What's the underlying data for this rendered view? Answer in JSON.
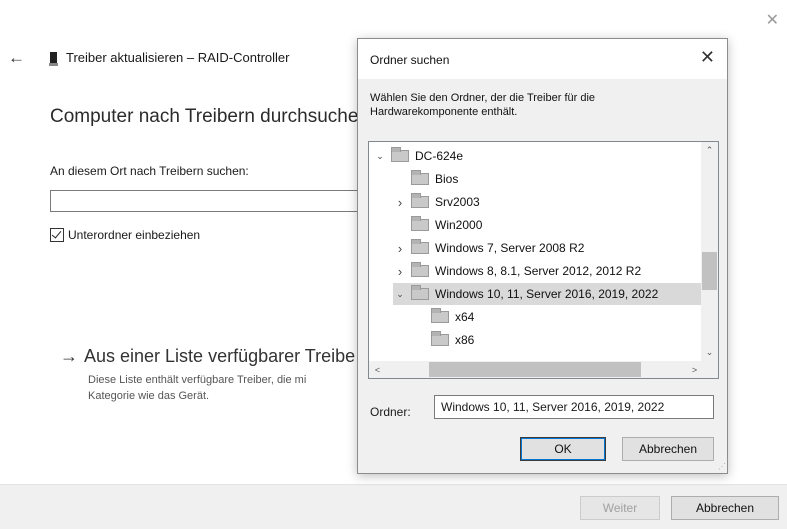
{
  "wizard": {
    "title": "Treiber aktualisieren – RAID-Controller",
    "heading": "Computer nach Treibern durchsuchen",
    "path_label": "An diesem Ort nach Treibern suchen:",
    "path_value": "",
    "include_subfolders_label": "Unterordner einbeziehen",
    "include_subfolders_checked": true,
    "list_link_label": "Aus einer Liste verfügbarer Treibe",
    "list_link_desc_line1": "Diese Liste enthält verfügbare Treiber, die mi",
    "list_link_desc_line2": "Kategorie wie das Gerät.",
    "next_label": "Weiter",
    "cancel_label": "Abbrechen"
  },
  "dialog": {
    "title": "Ordner suchen",
    "description": "Wählen Sie den Ordner, der die Treiber für die Hardwarekomponente enthält.",
    "tree": [
      {
        "label": "DC-624e",
        "expander": "expanded",
        "level": 0,
        "selected": false
      },
      {
        "label": "Bios",
        "expander": "none",
        "level": 1,
        "selected": false
      },
      {
        "label": "Srv2003",
        "expander": "collapsed",
        "level": 1,
        "selected": false
      },
      {
        "label": "Win2000",
        "expander": "none",
        "level": 1,
        "selected": false
      },
      {
        "label": "Windows 7, Server 2008 R2",
        "expander": "collapsed",
        "level": 1,
        "selected": false
      },
      {
        "label": "Windows 8, 8.1, Server 2012, 2012 R2",
        "expander": "collapsed",
        "level": 1,
        "selected": false
      },
      {
        "label": "Windows 10, 11, Server 2016, 2019, 2022",
        "expander": "expanded",
        "level": 1,
        "selected": true
      },
      {
        "label": "x64",
        "expander": "none",
        "level": 2,
        "selected": false
      },
      {
        "label": "x86",
        "expander": "none",
        "level": 2,
        "selected": false
      }
    ],
    "folder_label": "Ordner:",
    "folder_value": "Windows 10, 11, Server 2016, 2019, 2022",
    "ok_label": "OK",
    "cancel_label": "Abbrechen"
  },
  "icons": {
    "close": "close-icon",
    "back": "back-arrow-icon",
    "folder": "folder-icon"
  }
}
